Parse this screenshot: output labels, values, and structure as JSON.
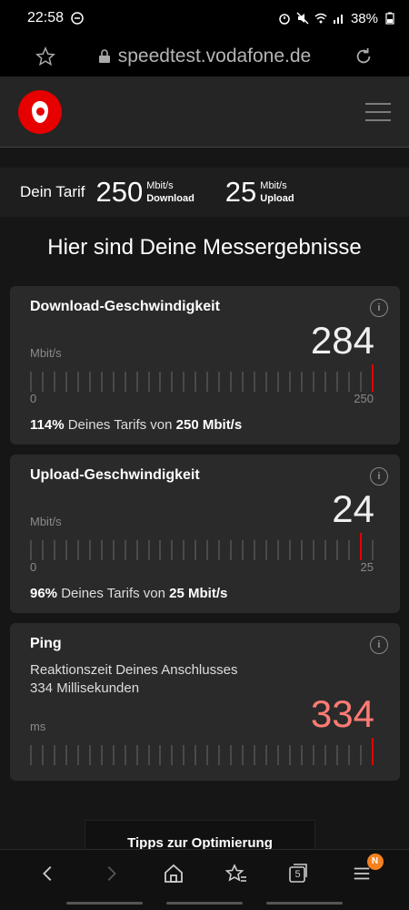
{
  "status_bar": {
    "time": "22:58",
    "battery": "38%"
  },
  "browser": {
    "url": "speedtest.vodafone.de"
  },
  "tariff": {
    "label": "Dein Tarif",
    "download_value": "250",
    "download_unit": "Mbit/s",
    "download_label": "Download",
    "upload_value": "25",
    "upload_unit": "Mbit/s",
    "upload_label": "Upload"
  },
  "headline": "Hier sind Deine Messergebnisse",
  "download": {
    "title": "Download-Geschwindigkeit",
    "info": "i",
    "value": "284",
    "unit": "Mbit/s",
    "scale_min": "0",
    "scale_max": "250",
    "percent": "114%",
    "summary_mid": "Deines Tarifs von",
    "summary_value": "250 Mbit/s",
    "level": 1.0
  },
  "upload": {
    "title": "Upload-Geschwindigkeit",
    "info": "i",
    "value": "24",
    "unit": "Mbit/s",
    "scale_min": "0",
    "scale_max": "25",
    "percent": "96%",
    "summary_mid": "Deines Tarifs von",
    "summary_value": "25 Mbit/s",
    "level": 0.96
  },
  "ping": {
    "title": "Ping",
    "info": "i",
    "desc_line1": "Reaktionszeit Deines Anschlusses",
    "desc_line2": "334 Millisekunden",
    "value": "334",
    "unit": "ms",
    "value_color": "#ff7b73",
    "level": 1.0
  },
  "tips": {
    "label": "Tipps zur Optimierung"
  },
  "bottom_nav": {
    "tabs_count": "5",
    "menu_badge": "N"
  },
  "colors": {
    "accent": "#e60000",
    "background": "#161616",
    "card": "#2a2a2a"
  }
}
